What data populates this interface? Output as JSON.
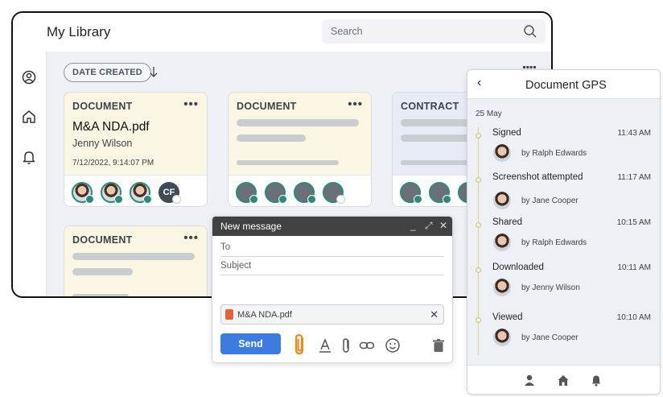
{
  "library": {
    "title": "My Library",
    "search_placeholder": "Search",
    "sort_label": "DATE CREATED",
    "cards": [
      {
        "type": "DOCUMENT",
        "name": "M&A NDA.pdf",
        "owner": "Jenny Wilson",
        "date": "7/12/2022, 9:14:07 PM",
        "avatar_initials": "CF"
      },
      {
        "type": "DOCUMENT"
      },
      {
        "type": "CONTRACT"
      },
      {
        "type": "DOCUMENT"
      }
    ],
    "menu_glyph": "•••"
  },
  "compose": {
    "title": "New message",
    "to_label": "To",
    "subject_label": "Subject",
    "attachment_name": "M&A NDA.pdf",
    "send_label": "Send",
    "ctl_minimize": "_",
    "ctl_expand": "⤢",
    "ctl_close": "✕",
    "attach_close": "✕"
  },
  "gps": {
    "back": "‹",
    "title": "Document GPS",
    "date": "25 May",
    "events": [
      {
        "name": "Signed",
        "time": "11:43 AM",
        "by": "by Ralph Edwards"
      },
      {
        "name": "Screenshot attempted",
        "time": "11:17 AM",
        "by": "by Jane Cooper"
      },
      {
        "name": "Shared",
        "time": "10:15 AM",
        "by": "by Ralph Edwards"
      },
      {
        "name": "Downloaded",
        "time": "10:11 AM",
        "by": "by Jenny Wilson"
      },
      {
        "name": "Viewed",
        "time": "10:10 AM",
        "by": "by Jane Cooper"
      }
    ]
  },
  "colors": {
    "accent": "#3c7be0",
    "teal": "#2b8a7a",
    "card_yellow": "#fbf6e3",
    "card_blue": "#e7ebf6",
    "compose_header": "#404143"
  }
}
